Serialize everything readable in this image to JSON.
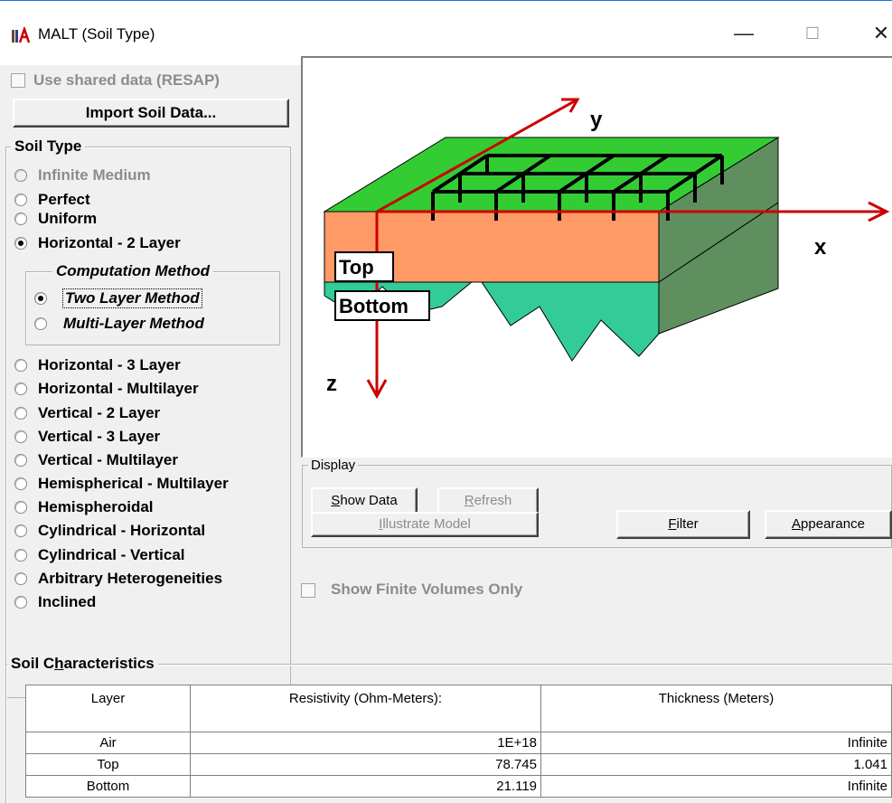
{
  "window": {
    "title": "MALT (Soil Type)",
    "minimize": "—",
    "maximize": "☐",
    "close": "✕"
  },
  "shared_data": {
    "label": "Use shared data (RESAP)",
    "checked": false,
    "enabled": false
  },
  "import_button": "Import Soil Data...",
  "soil_type": {
    "label": "Soil Type",
    "options": [
      {
        "label": "Infinite Medium",
        "selected": false,
        "enabled": false
      },
      {
        "label": "Perfect",
        "selected": false,
        "enabled": true
      },
      {
        "label": "Uniform",
        "selected": false,
        "enabled": true
      },
      {
        "label": "Horizontal - 2 Layer",
        "selected": true,
        "enabled": true
      },
      {
        "label": "Horizontal - 3 Layer",
        "selected": false,
        "enabled": true
      },
      {
        "label": "Horizontal - Multilayer",
        "selected": false,
        "enabled": true
      },
      {
        "label": "Vertical - 2 Layer",
        "selected": false,
        "enabled": true
      },
      {
        "label": "Vertical - 3 Layer",
        "selected": false,
        "enabled": true
      },
      {
        "label": "Vertical - Multilayer",
        "selected": false,
        "enabled": true
      },
      {
        "label": "Hemispherical - Multilayer",
        "selected": false,
        "enabled": true
      },
      {
        "label": "Hemispheroidal",
        "selected": false,
        "enabled": true
      },
      {
        "label": "Cylindrical - Horizontal",
        "selected": false,
        "enabled": true
      },
      {
        "label": "Cylindrical - Vertical",
        "selected": false,
        "enabled": true
      },
      {
        "label": "Arbitrary Heterogeneities",
        "selected": false,
        "enabled": true
      },
      {
        "label": "Inclined",
        "selected": false,
        "enabled": true
      }
    ]
  },
  "computation_method": {
    "label": "Computation Method",
    "options": [
      {
        "label": "Two Layer Method",
        "selected": true
      },
      {
        "label": "Multi-Layer Method",
        "selected": false
      }
    ]
  },
  "illustration": {
    "axis_x": "x",
    "axis_y": "y",
    "axis_z": "z",
    "top_label": "Top",
    "bottom_label": "Bottom",
    "colors": {
      "surface": "#33cc33",
      "top_layer": "#ff9966",
      "bottom_layer": "#33cc99",
      "axis": "#cc0000"
    }
  },
  "display": {
    "label": "Display",
    "show_data": "Show Data",
    "refresh": "Refresh",
    "illustrate_model": "Illustrate Model",
    "filter": "Filter",
    "appearance": "Appearance"
  },
  "finite_volumes": {
    "label": "Show Finite Volumes Only",
    "checked": false,
    "enabled": false
  },
  "soil_characteristics": {
    "label": "Soil Characteristics",
    "headers": [
      "Layer",
      "Resistivity (Ohm-Meters):",
      "Thickness (Meters)"
    ],
    "rows": [
      {
        "layer": "Air",
        "resistivity": "1E+18",
        "thickness": "Infinite"
      },
      {
        "layer": "Top",
        "resistivity": "78.745",
        "thickness": "1.041"
      },
      {
        "layer": "Bottom",
        "resistivity": "21.119",
        "thickness": "Infinite"
      }
    ]
  }
}
